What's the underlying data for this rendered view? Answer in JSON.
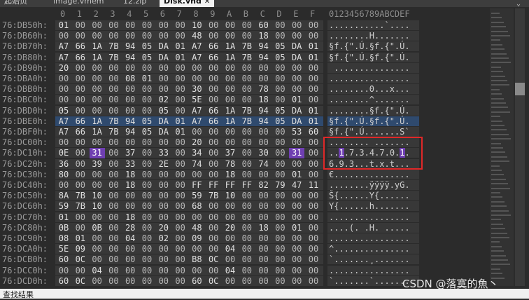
{
  "tabs": [
    {
      "label": "起始页",
      "active": false
    },
    {
      "label": "image.vmem",
      "active": false
    },
    {
      "label": "12.zip",
      "active": false
    },
    {
      "label": "Disk.vhd",
      "active": true
    }
  ],
  "hex_header": [
    "0",
    "1",
    "2",
    "3",
    "4",
    "5",
    "6",
    "7",
    "8",
    "9",
    "A",
    "B",
    "C",
    "D",
    "E",
    "F"
  ],
  "ascii_header": "0123456789ABCDEF",
  "rows": [
    {
      "addr": "76:DB50h:",
      "hex": [
        "01",
        "00",
        "00",
        "00",
        "00",
        "00",
        "00",
        "00",
        "10",
        "00",
        "00",
        "00",
        "60",
        "00",
        "00",
        "00"
      ],
      "ascii": "...........`...."
    },
    {
      "addr": "76:DB60h:",
      "hex": [
        "00",
        "00",
        "00",
        "00",
        "00",
        "00",
        "00",
        "00",
        "48",
        "00",
        "00",
        "00",
        "18",
        "00",
        "00",
        "00"
      ],
      "ascii": "........H......."
    },
    {
      "addr": "76:DB70h:",
      "hex": [
        "A7",
        "66",
        "1A",
        "7B",
        "94",
        "05",
        "DA",
        "01",
        "A7",
        "66",
        "1A",
        "7B",
        "94",
        "05",
        "DA",
        "01"
      ],
      "ascii": "§f.{\".Ú.§f.{\".Ú."
    },
    {
      "addr": "76:DB80h:",
      "hex": [
        "A7",
        "66",
        "1A",
        "7B",
        "94",
        "05",
        "DA",
        "01",
        "A7",
        "66",
        "1A",
        "7B",
        "94",
        "05",
        "DA",
        "01"
      ],
      "ascii": "§f.{\".Ú.§f.{\".Ú."
    },
    {
      "addr": "76:DB90h:",
      "hex": [
        "20",
        "00",
        "00",
        "00",
        "00",
        "00",
        "00",
        "00",
        "00",
        "00",
        "00",
        "00",
        "00",
        "00",
        "00",
        "00"
      ],
      "ascii": " ..............."
    },
    {
      "addr": "76:DBA0h:",
      "hex": [
        "00",
        "00",
        "00",
        "00",
        "08",
        "01",
        "00",
        "00",
        "00",
        "00",
        "00",
        "00",
        "00",
        "00",
        "00",
        "00"
      ],
      "ascii": "................"
    },
    {
      "addr": "76:DBB0h:",
      "hex": [
        "00",
        "00",
        "00",
        "00",
        "00",
        "00",
        "00",
        "00",
        "30",
        "00",
        "00",
        "00",
        "78",
        "00",
        "00",
        "00"
      ],
      "ascii": "........0...x..."
    },
    {
      "addr": "76:DBC0h:",
      "hex": [
        "00",
        "00",
        "00",
        "00",
        "00",
        "00",
        "02",
        "00",
        "5E",
        "00",
        "00",
        "00",
        "18",
        "00",
        "01",
        "00"
      ],
      "ascii": "........^......."
    },
    {
      "addr": "76:DBD0h:",
      "hex": [
        "05",
        "00",
        "00",
        "00",
        "00",
        "00",
        "05",
        "00",
        "A7",
        "66",
        "1A",
        "7B",
        "94",
        "05",
        "DA",
        "01"
      ],
      "ascii": "........§f.{\".Ú."
    },
    {
      "addr": "76:DBE0h:",
      "hex": [
        "A7",
        "66",
        "1A",
        "7B",
        "94",
        "05",
        "DA",
        "01",
        "A7",
        "66",
        "1A",
        "7B",
        "94",
        "05",
        "DA",
        "01"
      ],
      "ascii": "§f.{\".Ú.§f.{\".Ú.",
      "selected": true
    },
    {
      "addr": "76:DBF0h:",
      "hex": [
        "A7",
        "66",
        "1A",
        "7B",
        "94",
        "05",
        "DA",
        "01",
        "00",
        "00",
        "00",
        "00",
        "00",
        "00",
        "53",
        "60"
      ],
      "ascii": "§f.{\".Ú.......S`"
    },
    {
      "addr": "76:DC00h:",
      "hex": [
        "00",
        "00",
        "00",
        "00",
        "00",
        "00",
        "00",
        "00",
        "20",
        "00",
        "00",
        "00",
        "00",
        "00",
        "00",
        "00"
      ],
      "ascii": "........ ......."
    },
    {
      "addr": "76:DC10h:",
      "hex": [
        "0E",
        "00",
        "31",
        "00",
        "37",
        "00",
        "33",
        "00",
        "34",
        "00",
        "37",
        "00",
        "30",
        "00",
        "31",
        "00"
      ],
      "ascii": "..1.7.3.4.7.0.1.",
      "hl": [
        2,
        14
      ]
    },
    {
      "addr": "76:DC20h:",
      "hex": [
        "36",
        "00",
        "39",
        "00",
        "33",
        "00",
        "2E",
        "00",
        "74",
        "00",
        "78",
        "00",
        "74",
        "00",
        "00",
        "00"
      ],
      "ascii": "6.9.3...t.x.t..."
    },
    {
      "addr": "76:DC30h:",
      "hex": [
        "80",
        "00",
        "00",
        "00",
        "18",
        "00",
        "00",
        "00",
        "00",
        "00",
        "18",
        "00",
        "00",
        "00",
        "01",
        "00"
      ],
      "ascii": "€..............."
    },
    {
      "addr": "76:DC40h:",
      "hex": [
        "00",
        "00",
        "00",
        "00",
        "18",
        "00",
        "00",
        "00",
        "FF",
        "FF",
        "FF",
        "FF",
        "82",
        "79",
        "47",
        "11"
      ],
      "ascii": "........ÿÿÿÿ.yG."
    },
    {
      "addr": "76:DC50h:",
      "hex": [
        "8A",
        "7B",
        "10",
        "00",
        "00",
        "00",
        "00",
        "00",
        "59",
        "7B",
        "10",
        "00",
        "00",
        "00",
        "00",
        "00"
      ],
      "ascii": "Š{......Y{......"
    },
    {
      "addr": "76:DC60h:",
      "hex": [
        "59",
        "7B",
        "10",
        "00",
        "00",
        "00",
        "00",
        "00",
        "68",
        "00",
        "00",
        "00",
        "00",
        "00",
        "00",
        "00"
      ],
      "ascii": "Y{......h......."
    },
    {
      "addr": "76:DC70h:",
      "hex": [
        "01",
        "00",
        "00",
        "00",
        "18",
        "00",
        "00",
        "00",
        "00",
        "00",
        "00",
        "00",
        "00",
        "00",
        "00",
        "00"
      ],
      "ascii": "................"
    },
    {
      "addr": "76:DC80h:",
      "hex": [
        "0B",
        "00",
        "0B",
        "00",
        "28",
        "00",
        "20",
        "00",
        "48",
        "00",
        "20",
        "00",
        "18",
        "00",
        "01",
        "00"
      ],
      "ascii": "....(. .H. ....."
    },
    {
      "addr": "76:DC90h:",
      "hex": [
        "08",
        "01",
        "00",
        "00",
        "04",
        "00",
        "02",
        "00",
        "09",
        "00",
        "00",
        "00",
        "00",
        "00",
        "00",
        "00"
      ],
      "ascii": "................"
    },
    {
      "addr": "76:DCA0h:",
      "hex": [
        "5E",
        "09",
        "00",
        "00",
        "00",
        "00",
        "00",
        "00",
        "00",
        "00",
        "04",
        "00",
        "00",
        "00",
        "00",
        "00"
      ],
      "ascii": "^..............."
    },
    {
      "addr": "76:DCB0h:",
      "hex": [
        "60",
        "0C",
        "00",
        "00",
        "00",
        "00",
        "00",
        "00",
        "B8",
        "0C",
        "00",
        "00",
        "00",
        "00",
        "00",
        "00"
      ],
      "ascii": "`.......¸......."
    },
    {
      "addr": "76:DCC0h:",
      "hex": [
        "00",
        "00",
        "04",
        "00",
        "00",
        "00",
        "00",
        "00",
        "00",
        "00",
        "04",
        "00",
        "00",
        "00",
        "00",
        "00"
      ],
      "ascii": "................"
    },
    {
      "addr": "76:DCD0h:",
      "hex": [
        "60",
        "0C",
        "00",
        "00",
        "00",
        "00",
        "00",
        "00",
        "60",
        "0C",
        "00",
        "00",
        "00",
        "00",
        "00",
        "00"
      ],
      "ascii": "`.......`......."
    }
  ],
  "status_text": "查找结果",
  "watermark": "CSDN @落寞的魚丶"
}
